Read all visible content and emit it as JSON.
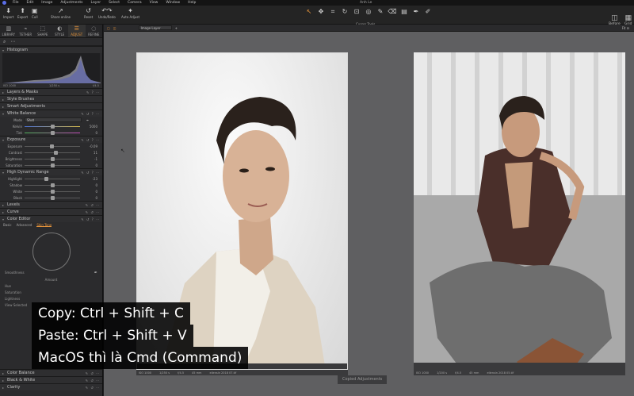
{
  "menubar": {
    "items": [
      "File",
      "Edit",
      "Image",
      "Adjustments",
      "Layer",
      "Select",
      "Camera",
      "View",
      "Window",
      "Help"
    ],
    "window_title": "Anh Le"
  },
  "toolbar": {
    "buttons": [
      {
        "label": "Import",
        "icon": "import-icon"
      },
      {
        "label": "Export",
        "icon": "export-icon"
      },
      {
        "label": "Cull",
        "icon": "cull-icon"
      },
      {
        "label": "Share online",
        "icon": "share-icon"
      },
      {
        "label": "Reset",
        "icon": "reset-icon"
      },
      {
        "label": "Undo/Redo",
        "icon": "undo-icon"
      },
      {
        "label": "Auto Adjust",
        "icon": "wand-icon"
      }
    ],
    "cursor_tools_label": "Cursor Tools",
    "right_buttons": [
      {
        "label": "Before",
        "icon": "before-icon"
      },
      {
        "label": "Grid",
        "icon": "grid-icon"
      }
    ]
  },
  "left_tabs": [
    {
      "label": "LIBRARY",
      "icon": "library-icon"
    },
    {
      "label": "TETHER",
      "icon": "tether-icon"
    },
    {
      "label": "SHAPE",
      "icon": "shape-icon"
    },
    {
      "label": "STYLE",
      "icon": "style-icon"
    },
    {
      "label": "ADJUST",
      "icon": "adjust-icon",
      "active": true
    },
    {
      "label": "REFINE",
      "icon": "refine-icon"
    }
  ],
  "histogram": {
    "title": "Histogram",
    "iso": "ISO 1000",
    "shutter": "1/250 s",
    "aperture": "f/4.5"
  },
  "sections": {
    "layers": "Layers & Masks",
    "style_brushes": "Style Brushes",
    "smart_adjustments": "Smart Adjustments",
    "white_balance": {
      "title": "White Balance",
      "mode_label": "Mode",
      "mode_value": "Shot",
      "rows": [
        {
          "label": "Kelvin",
          "value": "5000",
          "pos": 0.5
        },
        {
          "label": "Tint",
          "value": "0",
          "pos": 0.5
        }
      ]
    },
    "exposure": {
      "title": "Exposure",
      "rows": [
        {
          "label": "Exposure",
          "value": "-0.09",
          "pos": 0.49
        },
        {
          "label": "Contrast",
          "value": "11",
          "pos": 0.55
        },
        {
          "label": "Brightness",
          "value": "-1",
          "pos": 0.5
        },
        {
          "label": "Saturation",
          "value": "0",
          "pos": 0.5
        }
      ]
    },
    "hdr": {
      "title": "High Dynamic Range",
      "rows": [
        {
          "label": "Highlight",
          "value": "-23",
          "pos": 0.38
        },
        {
          "label": "Shadow",
          "value": "0",
          "pos": 0.5
        },
        {
          "label": "White",
          "value": "0",
          "pos": 0.5
        },
        {
          "label": "Black",
          "value": "0",
          "pos": 0.5
        }
      ]
    },
    "levels": "Levels",
    "curve": "Curve",
    "color_editor": {
      "title": "Color Editor",
      "tabs": [
        "Basic",
        "Advanced",
        "Skin Tone"
      ],
      "active_tab": "Skin Tone",
      "smoothness": "Smoothness",
      "amount": "Amount",
      "hue": "Hue",
      "saturation": "Saturation",
      "lightness": "Lightness",
      "view_selected": "View Selected"
    },
    "color_balance": "Color Balance",
    "black_white": "Black & White",
    "clarity": "Clarity"
  },
  "viewer": {
    "layer_select": "Image Layer",
    "photo1_info": [
      "ISO 1000",
      "1/250 s",
      "f/4.5",
      "45 mm",
      "ellensin 2018 07.tif"
    ],
    "photo2_info": [
      "ISO 1000",
      "1/200 s",
      "f/4.5",
      "45 mm",
      "ellensin 2018 05.tif"
    ],
    "tooltip": "Copied Adjustments"
  },
  "overlay": {
    "line1": "Copy: Ctrl + Shift + C",
    "line2": "Paste: Ctrl + Shift + V",
    "line3": "MacOS thì là Cmd (Command)"
  },
  "colors": {
    "accent": "#e8953b",
    "panel": "#2b2b2d",
    "canvas": "#5f5f61"
  }
}
